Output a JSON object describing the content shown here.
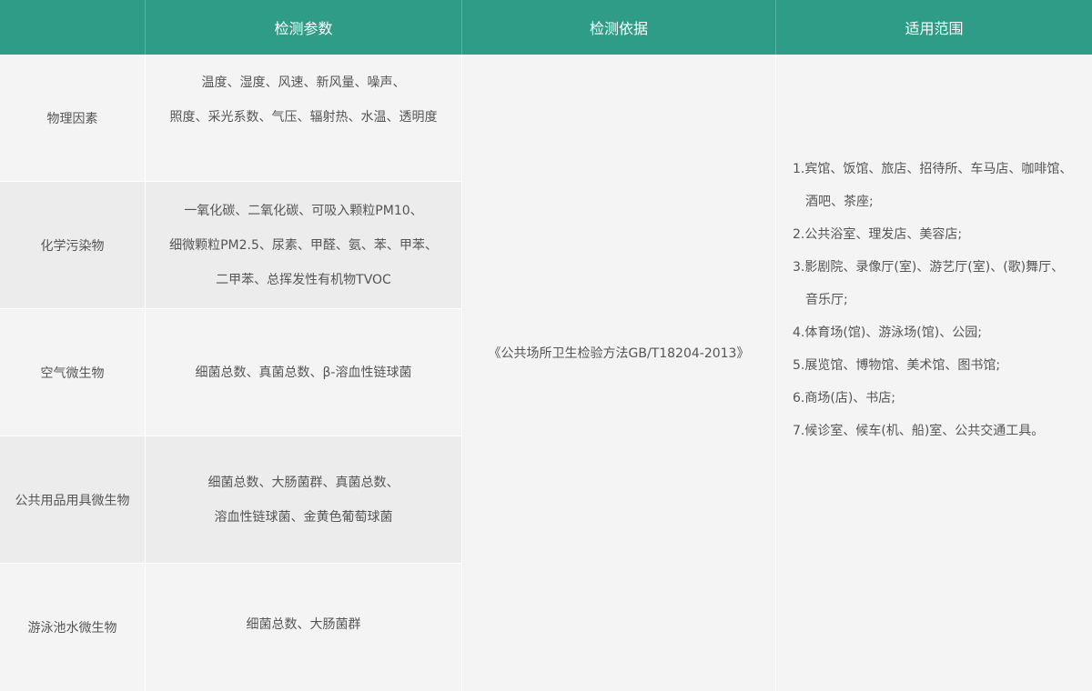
{
  "header": {
    "col1": "",
    "col2": "检测参数",
    "col3": "检测依据",
    "col4": "适用范围"
  },
  "rows": [
    {
      "category": "物理因素",
      "params": [
        "温度、湿度、风速、新风量、噪声、",
        "照度、采光系数、气压、辐射热、水温、透明度"
      ]
    },
    {
      "category": "化学污染物",
      "params": [
        "一氧化碳、二氧化碳、可吸入颗粒PM10、",
        "细微颗粒PM2.5、尿素、甲醛、氨、苯、甲苯、",
        "二甲苯、总挥发性有机物TVOC"
      ]
    },
    {
      "category": "空气微生物",
      "params": [
        "细菌总数、真菌总数、β-溶血性链球菌"
      ]
    },
    {
      "category": "公共用品用具微生物",
      "params": [
        "细菌总数、大肠菌群、真菌总数、",
        "溶血性链球菌、金黄色葡萄球菌"
      ]
    },
    {
      "category": "游泳池水微生物",
      "params": [
        "细菌总数、大肠菌群"
      ]
    }
  ],
  "basis": "《公共场所卫生检验方法GB/T18204-2013》",
  "scope": [
    "1.宾馆、饭馆、旅店、招待所、车马店、咖啡馆、",
    "酒吧、茶座;",
    "2.公共浴室、理发店、美容店;",
    "3.影剧院、录像厅(室)、游艺厅(室)、(歌)舞厅、",
    "音乐厅;",
    "4.体育场(馆)、游泳场(馆)、公园;",
    "5.展览馆、博物馆、美术馆、图书馆;",
    "6.商场(店)、书店;",
    "7.候诊室、候车(机、船)室、公共交通工具。"
  ],
  "colors": {
    "header_bg": "#2f9c88",
    "row_bg_a": "#f4f4f4",
    "row_bg_b": "#ececec",
    "text": "#555555"
  }
}
